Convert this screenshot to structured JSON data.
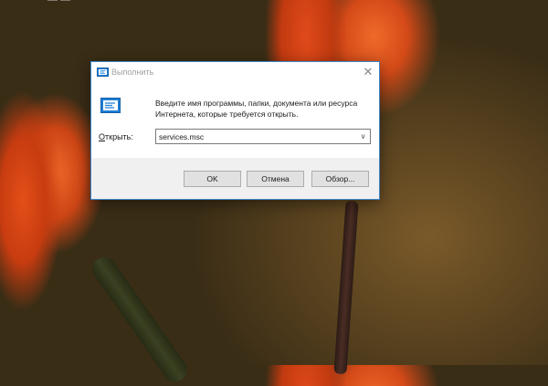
{
  "desktop": {
    "corner_text": "— —"
  },
  "dialog": {
    "title": "Выполнить",
    "close_glyph": "✕",
    "description_line1": "Введите имя программы, папки, документа или ресурса",
    "description_line2": "Интернета, которые требуется открыть.",
    "open_label_prefix": "",
    "open_label_underlined": "О",
    "open_label_rest": "ткрыть:",
    "input_value": "services.msc",
    "dropdown_glyph": "∨",
    "buttons": {
      "ok": "OK",
      "cancel": "Отмена",
      "browse": "Обзор..."
    },
    "icon_name": "run-dialog-icon",
    "accent_color": "#3c85c8"
  }
}
